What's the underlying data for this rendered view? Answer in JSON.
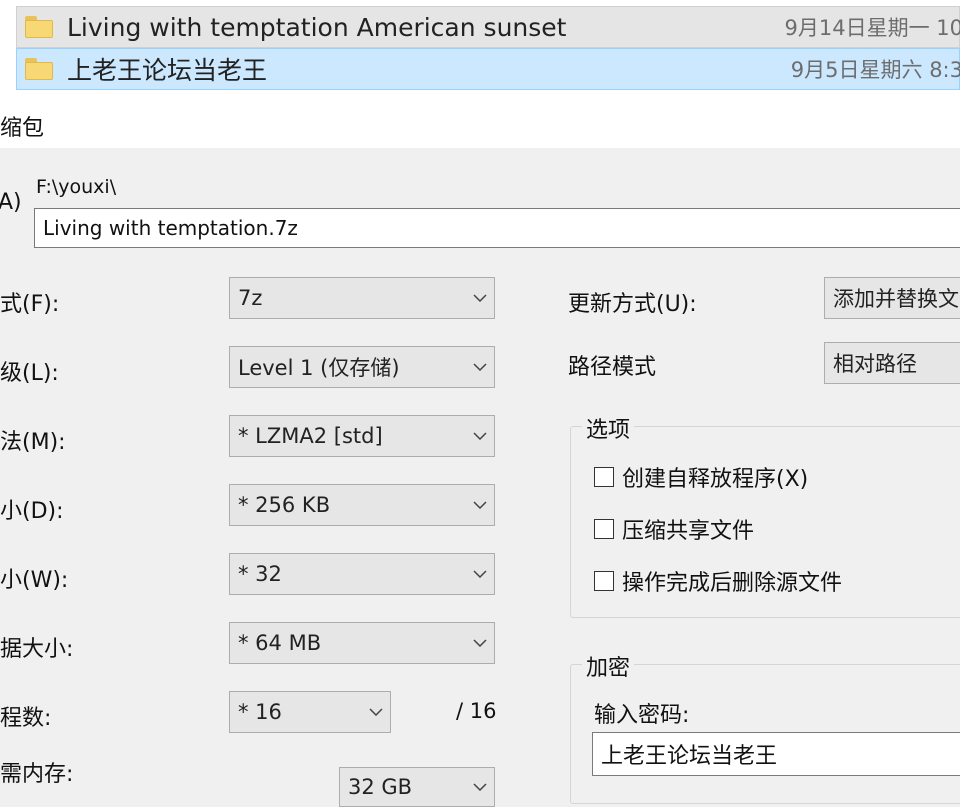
{
  "file_list": [
    {
      "name": "Living with temptation American sunset",
      "date": "9月14日星期一 10"
    },
    {
      "name": "上老王论坛当老王",
      "date": "9月5日星期六 8:3"
    }
  ],
  "dialog": {
    "title": "缩包",
    "archive_label": "A)",
    "path": "F:\\youxi\\",
    "archive_name": "Living with temptation.7z",
    "left_labels": {
      "format": "式(F):",
      "level": "级(L):",
      "method": "法(M):",
      "dict": "小(D):",
      "word": "小(W):",
      "solid": "据大小:",
      "threads": "程数:",
      "memory": "需内存:"
    },
    "values": {
      "format": "7z",
      "level": "Level 1 (仅存储)",
      "method": "*  LZMA2 [std]",
      "dict": "*  256 KB",
      "word": "*  32",
      "solid": "*  64 MB",
      "threads": "*  16",
      "threads_max": "/ 16",
      "memory": "32 GB"
    },
    "update_label": "更新方式(U):",
    "update_value": "添加并替换文",
    "pathmode_label": "路径模式",
    "pathmode_value": "相对路径",
    "options": {
      "title": "选项",
      "sfx": "创建自释放程序(X)",
      "shared": "压缩共享文件",
      "delete": "操作完成后删除源文件"
    },
    "encryption": {
      "title": "加密",
      "pw_label": "输入密码:",
      "pw_value": "上老王论坛当老王"
    }
  }
}
